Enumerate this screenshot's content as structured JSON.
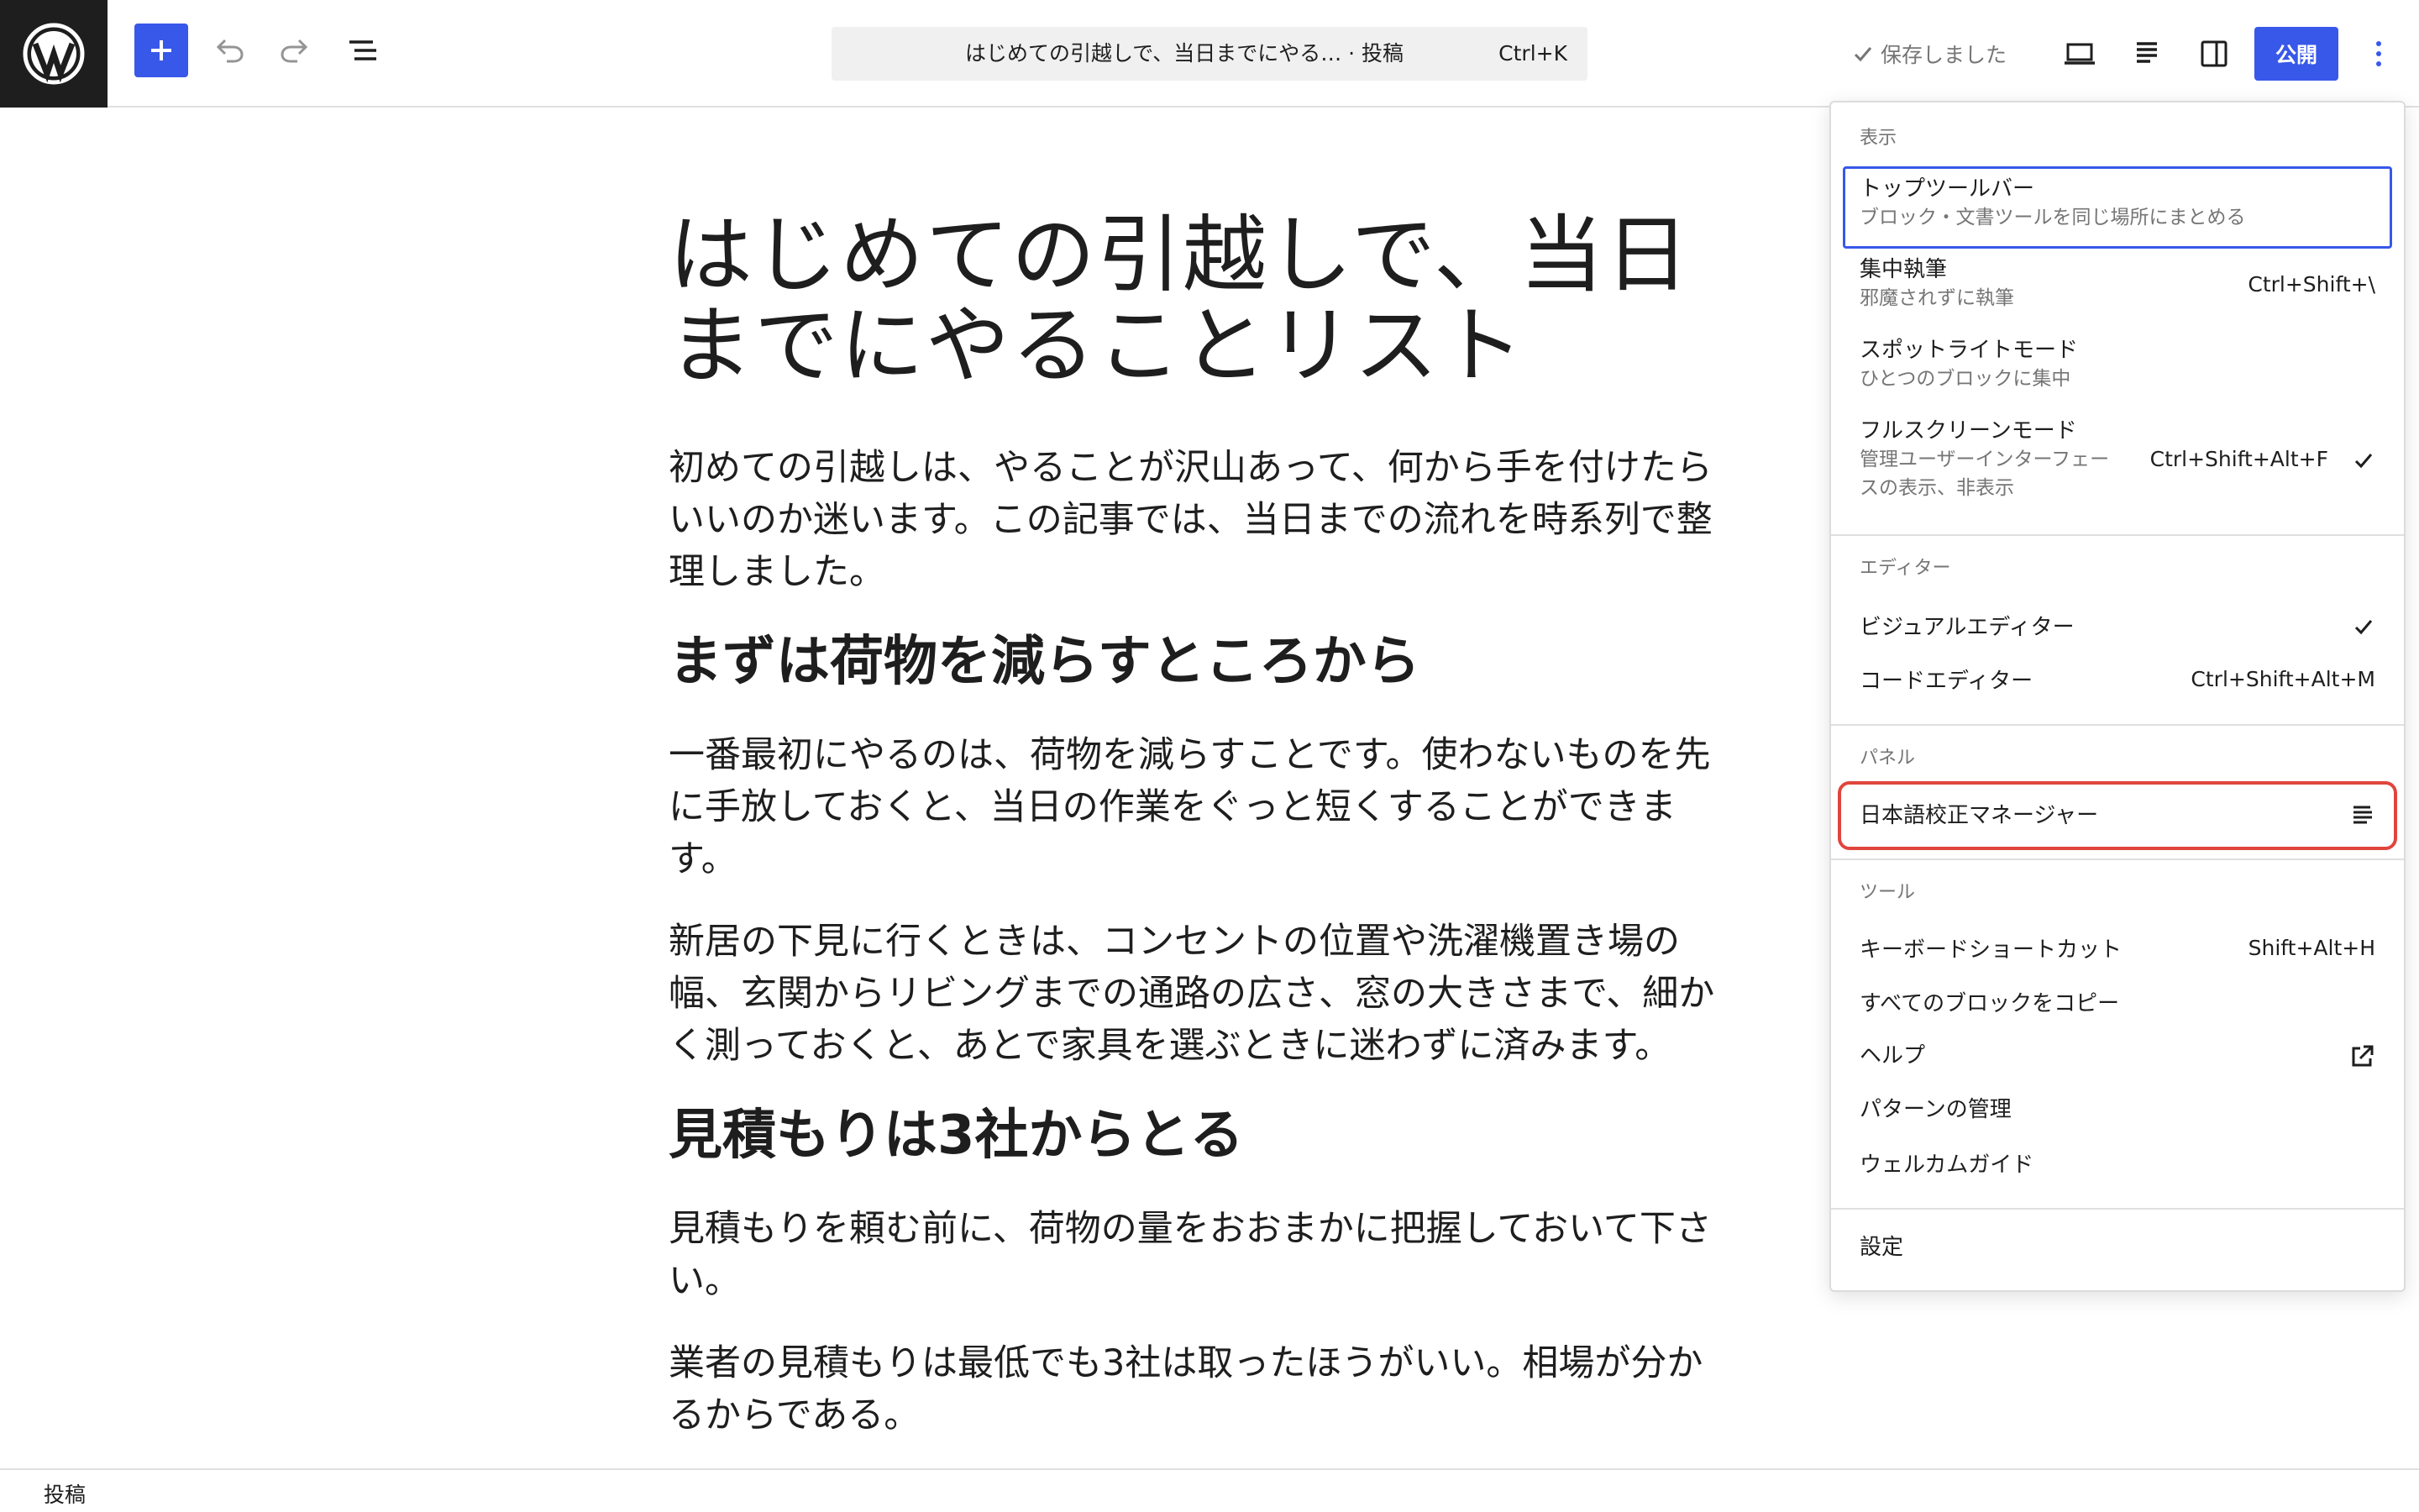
{
  "topbar": {
    "command_title": "はじめての引越しで、当日までにやる… · 投稿",
    "command_shortcut": "Ctrl+K",
    "saved_label": "保存しました",
    "publish_label": "公開"
  },
  "post": {
    "title": "はじめての引越しで、当日までにやることリスト",
    "blocks": [
      "初めての引越しは、やることが沢山あって、何から手を付けたらいいのか迷います。この記事では、当日までの流れを時系列で整理しました。",
      "まずは荷物を減らすところから",
      "一番最初にやるのは、荷物を減らすことです。使わないものを先に手放しておくと、当日の作業をぐっと短くすることができます。",
      "新居の下見に行くときは、コンセントの位置や洗濯機置き場の幅、玄関からリビングまでの通路の広さ、窓の大きさまで、細かく測っておくと、あとで家具を選ぶときに迷わずに済みます。",
      "見積もりは3社からとる",
      "見積もりを頼む前に、荷物の量をおおまかに把握しておいて下さい。",
      "業者の見積もりは最低でも3社は取ったほうがいい。相場が分かるからである。"
    ]
  },
  "footer": {
    "breadcrumb": "投稿"
  },
  "menu": {
    "view": {
      "label": "表示",
      "top_toolbar": {
        "label": "トップツールバー",
        "desc": "ブロック・文書ツールを同じ場所にまとめる"
      },
      "distraction_free": {
        "label": "集中執筆",
        "desc": "邪魔されずに執筆",
        "shortcut": "Ctrl+Shift+\\"
      },
      "spotlight": {
        "label": "スポットライトモード",
        "desc": "ひとつのブロックに集中"
      },
      "fullscreen": {
        "label": "フルスクリーンモード",
        "desc1": "管理ユーザーインターフェー",
        "desc2": "スの表示、非表示",
        "shortcut": "Ctrl+Shift+Alt+F"
      }
    },
    "editor": {
      "label": "エディター",
      "visual": {
        "label": "ビジュアルエディター"
      },
      "code": {
        "label": "コードエディター",
        "shortcut": "Ctrl+Shift+Alt+M"
      }
    },
    "panels": {
      "label": "パネル",
      "proofreader": {
        "label": "日本語校正マネージャー"
      }
    },
    "tools": {
      "label": "ツール",
      "keyboard": {
        "label": "キーボードショートカット",
        "shortcut": "Shift+Alt+H"
      },
      "copy_all": {
        "label": "すべてのブロックをコピー"
      },
      "help": {
        "label": "ヘルプ"
      },
      "patterns": {
        "label": "パターンの管理"
      },
      "welcome": {
        "label": "ウェルカムガイド"
      }
    },
    "preferences": {
      "label": "設定"
    }
  },
  "colors": {
    "accent": "#3858e9",
    "highlight": "#e0453c",
    "dark": "#1e1e1e"
  }
}
